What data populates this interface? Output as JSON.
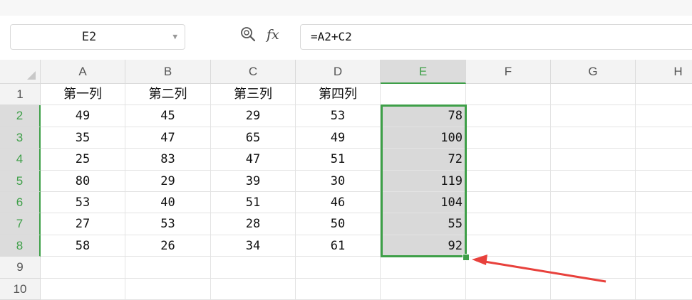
{
  "name_box": {
    "value": "E2"
  },
  "formula_bar": {
    "fx_label": "fx",
    "formula": "=A2+C2"
  },
  "columns": [
    "A",
    "B",
    "C",
    "D",
    "E",
    "F",
    "G",
    "H"
  ],
  "active_column": "E",
  "rows": [
    "1",
    "2",
    "3",
    "4",
    "5",
    "6",
    "7",
    "8",
    "9",
    "10"
  ],
  "active_rows": [
    "2",
    "3",
    "4",
    "5",
    "6",
    "7",
    "8"
  ],
  "cells": [
    [
      "第一列",
      "第二列",
      "第三列",
      "第四列",
      "",
      "",
      "",
      ""
    ],
    [
      "49",
      "45",
      "29",
      "53",
      "78",
      "",
      "",
      ""
    ],
    [
      "35",
      "47",
      "65",
      "49",
      "100",
      "",
      "",
      ""
    ],
    [
      "25",
      "83",
      "47",
      "51",
      "72",
      "",
      "",
      ""
    ],
    [
      "80",
      "29",
      "39",
      "30",
      "119",
      "",
      "",
      ""
    ],
    [
      "53",
      "40",
      "51",
      "46",
      "104",
      "",
      "",
      ""
    ],
    [
      "27",
      "53",
      "28",
      "50",
      "55",
      "",
      "",
      ""
    ],
    [
      "58",
      "26",
      "34",
      "61",
      "92",
      "",
      "",
      ""
    ],
    [
      "",
      "",
      "",
      "",
      "",
      "",
      "",
      ""
    ],
    [
      "",
      "",
      "",
      "",
      "",
      "",
      "",
      ""
    ]
  ],
  "selection_range": "E2:E8",
  "colors": {
    "accent": "#3e9f48",
    "selection_fill": "#d9d9d9",
    "annotation": "#e8413c"
  }
}
